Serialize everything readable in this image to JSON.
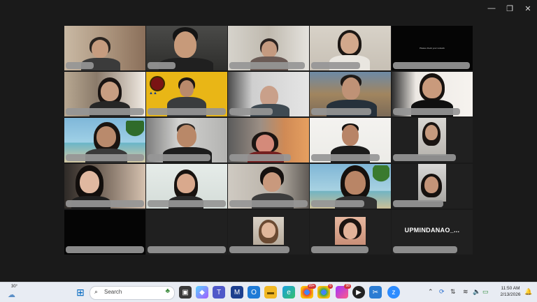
{
  "window": {
    "controls": {
      "minimize": "—",
      "restore": "❐",
      "close": "✕"
    }
  },
  "tiles": [
    {
      "id": 1,
      "kind": "video"
    },
    {
      "id": 2,
      "kind": "video",
      "active": true
    },
    {
      "id": 3,
      "kind": "video"
    },
    {
      "id": 4,
      "kind": "video"
    },
    {
      "id": 5,
      "kind": "black",
      "caption": "Please check your network"
    },
    {
      "id": 6,
      "kind": "video"
    },
    {
      "id": 7,
      "kind": "video"
    },
    {
      "id": 8,
      "kind": "video"
    },
    {
      "id": 9,
      "kind": "video"
    },
    {
      "id": 10,
      "kind": "video"
    },
    {
      "id": 11,
      "kind": "video"
    },
    {
      "id": 12,
      "kind": "video"
    },
    {
      "id": 13,
      "kind": "video"
    },
    {
      "id": 14,
      "kind": "video"
    },
    {
      "id": 15,
      "kind": "video"
    },
    {
      "id": 16,
      "kind": "video"
    },
    {
      "id": 17,
      "kind": "video"
    },
    {
      "id": 18,
      "kind": "video"
    },
    {
      "id": 19,
      "kind": "video"
    },
    {
      "id": 20,
      "kind": "video"
    },
    {
      "id": 21,
      "kind": "black"
    },
    {
      "id": 22,
      "kind": "dark"
    },
    {
      "id": 23,
      "kind": "avatar"
    },
    {
      "id": 24,
      "kind": "avatar"
    },
    {
      "id": 25,
      "kind": "name",
      "label": "UPMINDANAO_..."
    }
  ],
  "taskbar": {
    "weather": {
      "temp": "30°",
      "icon": "weather-cloud-icon"
    },
    "search_placeholder": "Search",
    "badges": {
      "chrome1": "99+",
      "chrome2": "6",
      "messenger": "98"
    },
    "clock": {
      "time": "11:50 AM",
      "date": "2/13/2026"
    }
  },
  "colors": {
    "background": "#1a1a1a",
    "active_speaker": "#2ecc71",
    "nameplate": "#969696",
    "taskbar": "#e8ecf3"
  }
}
